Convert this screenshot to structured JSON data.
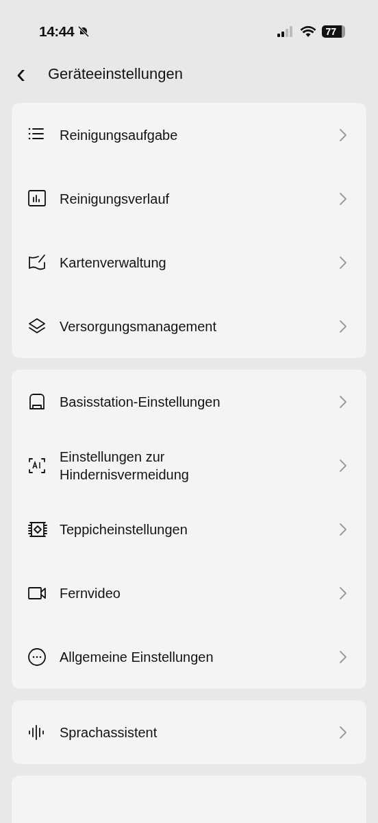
{
  "status_bar": {
    "time": "14:44",
    "battery": "77"
  },
  "header": {
    "back": "‹",
    "title": "Geräteeinstellungen"
  },
  "groups": [
    {
      "items": [
        {
          "label": "Reinigungsaufgabe"
        },
        {
          "label": "Reinigungsverlauf"
        },
        {
          "label": "Kartenverwaltung"
        },
        {
          "label": "Versorgungsmanagement"
        }
      ]
    },
    {
      "items": [
        {
          "label": "Basisstation-Einstellungen"
        },
        {
          "label": "Einstellungen zur Hindernisvermeidung"
        },
        {
          "label": "Teppicheinstellungen"
        },
        {
          "label": "Fernvideo"
        },
        {
          "label": "Allgemeine Einstellungen"
        }
      ]
    },
    {
      "items": [
        {
          "label": "Sprachassistent"
        }
      ]
    }
  ]
}
